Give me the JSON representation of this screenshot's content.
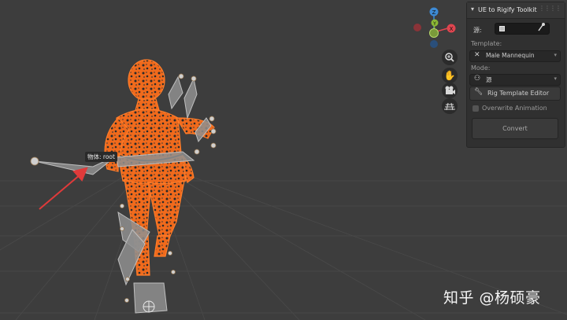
{
  "panel": {
    "title": "UE to Rigify Toolkit",
    "source_label": "源:",
    "template_label": "Template:",
    "template_value": "Male Mannequin",
    "mode_label": "Mode:",
    "mode_value": "源",
    "rig_template_editor_label": "Rig Template Editor",
    "overwrite_animation_label": "Overwrite Animation",
    "overwrite_animation_checked": false,
    "convert_label": "Convert"
  },
  "gizmo": {
    "z_label": "Z",
    "y_label": "Y",
    "x_label": "X",
    "colors": {
      "x": "#e0454f",
      "y": "#8bb935",
      "z": "#3d8ad4"
    }
  },
  "tooltip": "物体: root",
  "watermark": "知乎 @杨硕豪",
  "colors": {
    "viewport_bg": "#3d3d3d",
    "selection_orange": "#f06a1c",
    "annotation_red": "#e03a3a"
  }
}
